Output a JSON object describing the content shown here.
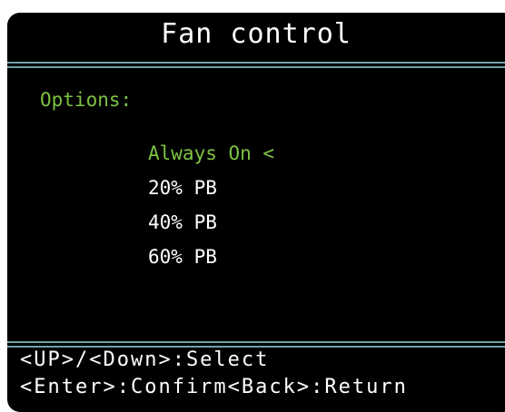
{
  "screen": {
    "title": "Fan control",
    "options_label": "Options:",
    "menu": {
      "items": [
        {
          "label": "Always On <",
          "selected": true
        },
        {
          "label": "20% PB",
          "selected": false
        },
        {
          "label": "40% PB",
          "selected": false
        },
        {
          "label": "60% PB",
          "selected": false
        }
      ]
    },
    "help": {
      "line1": "<UP>/<Down>:Select",
      "line2": "<Enter>:Confirm<Back>:Return"
    }
  },
  "colors": {
    "background": "#000000",
    "accent_green": "#7dc242",
    "rule": "#6fa0a8",
    "text": "#ffffff"
  }
}
